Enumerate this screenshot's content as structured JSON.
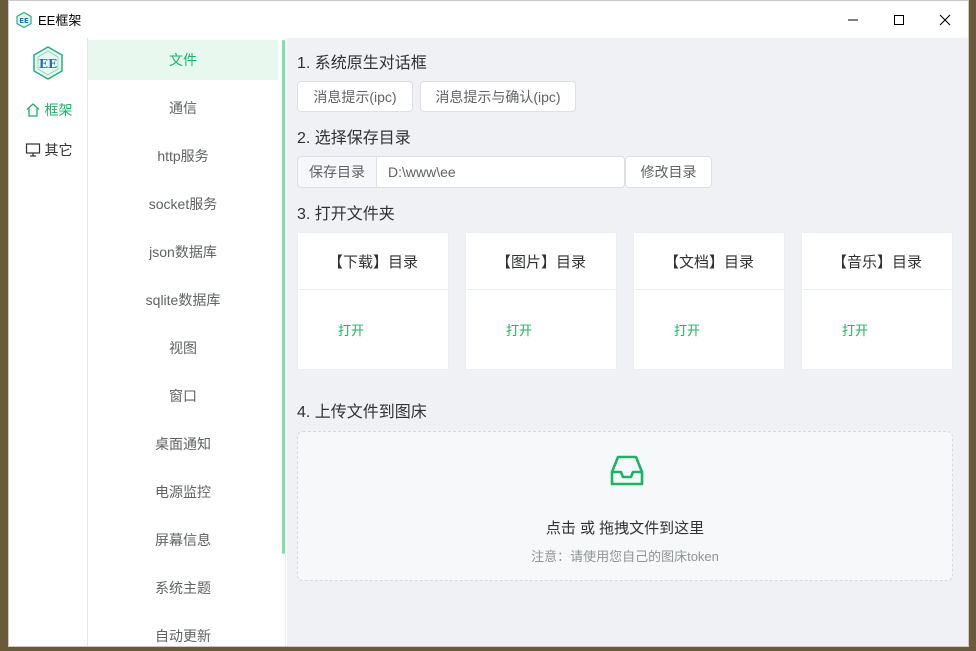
{
  "window": {
    "title": "EE框架",
    "accent": "#18b566"
  },
  "rail": {
    "items": [
      {
        "label": "框架",
        "icon": "home-icon",
        "active": true
      },
      {
        "label": "其它",
        "icon": "monitor-icon",
        "active": false
      }
    ]
  },
  "submenu": {
    "items": [
      {
        "label": "文件",
        "active": true
      },
      {
        "label": "通信"
      },
      {
        "label": "http服务"
      },
      {
        "label": "socket服务"
      },
      {
        "label": "json数据库"
      },
      {
        "label": "sqlite数据库"
      },
      {
        "label": "视图"
      },
      {
        "label": "窗口"
      },
      {
        "label": "桌面通知"
      },
      {
        "label": "电源监控"
      },
      {
        "label": "屏幕信息"
      },
      {
        "label": "系统主题"
      },
      {
        "label": "自动更新"
      }
    ]
  },
  "content": {
    "s1": {
      "title": "1. 系统原生对话框",
      "btn1": "消息提示(ipc)",
      "btn2": "消息提示与确认(ipc)"
    },
    "s2": {
      "title": "2. 选择保存目录",
      "prefix": "保存目录",
      "value": "D:\\www\\ee",
      "button": "修改目录"
    },
    "s3": {
      "title": "3. 打开文件夹",
      "cards": [
        {
          "head": "【下载】目录",
          "link": "打开"
        },
        {
          "head": "【图片】目录",
          "link": "打开"
        },
        {
          "head": "【文档】目录",
          "link": "打开"
        },
        {
          "head": "【音乐】目录",
          "link": "打开"
        }
      ]
    },
    "s4": {
      "title": "4. 上传文件到图床",
      "drop_text": "点击 或 拖拽文件到这里",
      "hint": "注意：请使用您自己的图床token",
      "icon": "inbox-icon"
    }
  }
}
